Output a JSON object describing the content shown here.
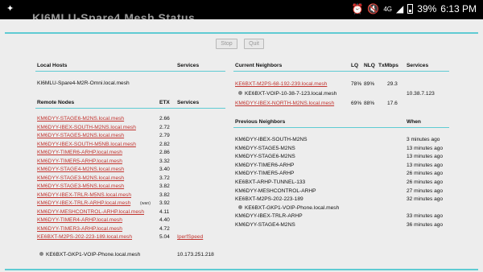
{
  "status_bar": {
    "left_glyph": "✦",
    "page_title": "KI6MLU-Spare4 Mesh Status",
    "network": "4G",
    "battery": "39%",
    "time": "6:13 PM"
  },
  "controls": {
    "stop_label": "Stop",
    "quit_label": "Quit"
  },
  "local_hosts": {
    "header": "Local Hosts",
    "services_header": "Services",
    "host": "KI6MLU-Spare4-M2R-Omni.local.mesh"
  },
  "remote_nodes": {
    "header": "Remote Nodes",
    "etx_header": "ETX",
    "services_header": "Services",
    "rows": [
      {
        "name": "KM6DYY-STAGE6-M2NS.local.mesh",
        "etx": "2.66"
      },
      {
        "name": "KM6DYY-IBEX-SOUTH-M2NS.local.mesh",
        "etx": "2.72"
      },
      {
        "name": "KM6DYY-STAGE5-M2NS.local.mesh",
        "etx": "2.79"
      },
      {
        "name": "KM6DYY-IBEX-SOUTH-M5NB.local.mesh",
        "etx": "2.82"
      },
      {
        "name": "KM6DYY-TIMER6-ARHP.local.mesh",
        "etx": "2.86"
      },
      {
        "name": "KM6DYY-TIMER5-ARHP.local.mesh",
        "etx": "3.32"
      },
      {
        "name": "KM6DYY-STAGE4-M2NS.local.mesh",
        "etx": "3.40"
      },
      {
        "name": "KM6DYY-STAGE3-M2NS.local.mesh",
        "etx": "3.72"
      },
      {
        "name": "KM6DYY-STAGE3-M5NS.local.mesh",
        "etx": "3.82"
      },
      {
        "name": "KM6DYY-IBEX-TRLR-M5NS.local.mesh",
        "etx": "3.82"
      },
      {
        "name": "KM6DYY-IBEX-TRLR-ARHP.local.mesh",
        "etx": "3.92",
        "tag": "(wan)"
      },
      {
        "name": "KM6DYY-MESHCONTROL-ARHP.local.mesh",
        "etx": "4.11"
      },
      {
        "name": "KM6DYY-TIMER4-ARHP.local.mesh",
        "etx": "4.40"
      },
      {
        "name": "KM6DYY-TIMER3-ARHP.local.mesh",
        "etx": "4.72"
      },
      {
        "name": "KE6BXT-M2PS-202-223-189.local.mesh",
        "etx": "5.04",
        "service": "IperfSpeed"
      }
    ],
    "sub_host": {
      "name": "KE6BXT-GKP1-VOIP-Phone.local.mesh",
      "ip": "10.173.251.218"
    }
  },
  "current_neighbors": {
    "header": "Current Neighbors",
    "lq_header": "LQ",
    "nlq_header": "NLQ",
    "txmbps_header": "TxMbps",
    "services_header": "Services",
    "rows": [
      {
        "name": "KE6BXT-M2PS-68-192-239.local.mesh",
        "lq": "78%",
        "nlq": "89%",
        "tx": "29.3"
      },
      {
        "name": "KM6DYY-IBEX-NORTH-M2NS.local.mesh",
        "lq": "69%",
        "nlq": "88%",
        "tx": "17.6"
      }
    ],
    "sub_host": {
      "name": "KE6BXT-VOIP-10-38-7-123.local.mesh",
      "ip": "10.38.7.123"
    }
  },
  "previous_neighbors": {
    "header": "Previous Neighbors",
    "when_header": "When",
    "rows": [
      {
        "name": "KM6DYY-IBEX-SOUTH-M2NS",
        "when": "3 minutes ago"
      },
      {
        "name": "KM6DYY-STAGE5-M2NS",
        "when": "13 minutes ago"
      },
      {
        "name": "KM6DYY-STAGE6-M2NS",
        "when": "13 minutes ago"
      },
      {
        "name": "KM6DYY-TIMER6-ARHP",
        "when": "13 minutes ago"
      },
      {
        "name": "KM6DYY-TIMER5-ARHP",
        "when": "26 minutes ago"
      },
      {
        "name": "KE6BXT-ARHP-TUNNEL-133",
        "when": "26 minutes ago"
      },
      {
        "name": "KM6DYY-MESHCONTROL-ARHP",
        "when": "27 minutes ago"
      },
      {
        "name": "KE6BXT-M2PS-202-223-189",
        "when": "32 minutes ago"
      },
      {
        "name": "KE6BXT-GKP1-VOIP-Phone.local.mesh",
        "when": "",
        "sub": true
      },
      {
        "name": "KM6DYY-IBEX-TRLR-ARHP",
        "when": "33 minutes ago"
      },
      {
        "name": "KM6DYY-STAGE4-M2NS",
        "when": "36 minutes ago"
      }
    ]
  }
}
